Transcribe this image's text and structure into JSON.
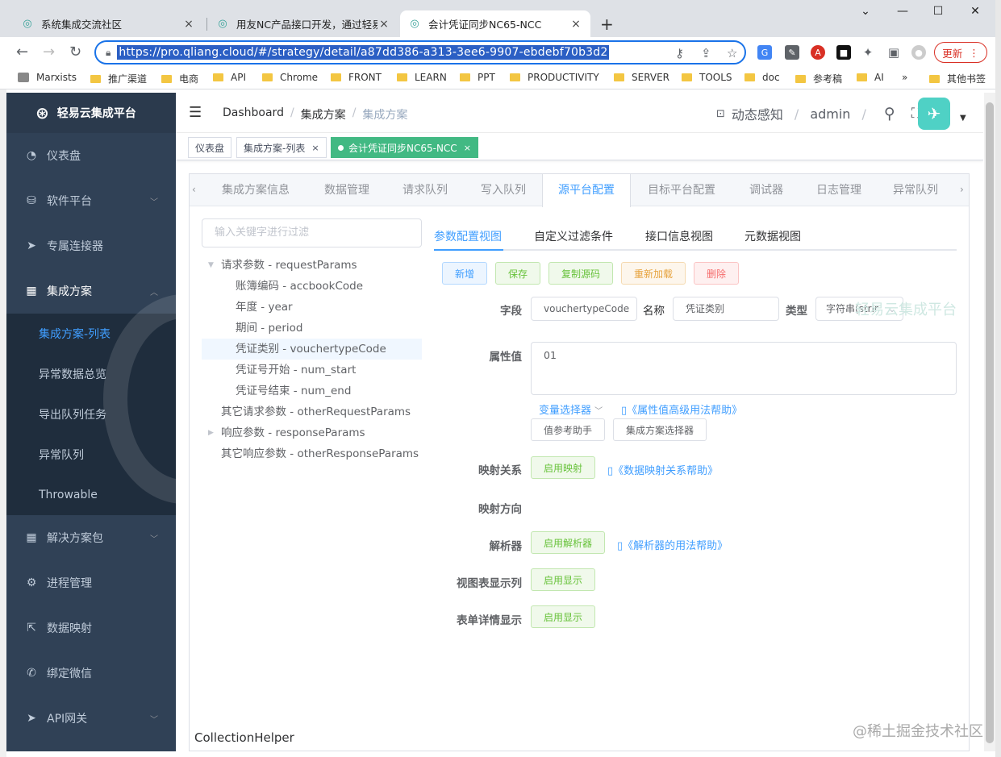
{
  "browser": {
    "tabs": [
      {
        "title": "系统集成交流社区"
      },
      {
        "title": "用友NC产品接口开发，通过轻易"
      },
      {
        "title": "会计凭证同步NC65-NCC"
      }
    ],
    "url": "https://pro.qliang.cloud/#/strategy/detail/a87dd386-a313-3ee6-9907-ebdebf70b3d2",
    "update_label": "更新",
    "bookmarks": [
      "Marxists",
      "推广渠道",
      "电商",
      "API",
      "Chrome",
      "FRONT",
      "LEARN",
      "PPT",
      "PRODUCTIVITY",
      "SERVER",
      "TOOLS",
      "doc",
      "参考稿",
      "AI",
      "其他书签"
    ]
  },
  "sidebar": {
    "logo": "轻易云集成平台",
    "items": [
      {
        "label": "仪表盘"
      },
      {
        "label": "软件平台"
      },
      {
        "label": "专属连接器"
      },
      {
        "label": "集成方案"
      },
      {
        "label": "解决方案包"
      },
      {
        "label": "进程管理"
      },
      {
        "label": "数据映射"
      },
      {
        "label": "绑定微信"
      },
      {
        "label": "API网关"
      }
    ],
    "subitems": [
      {
        "label": "集成方案-列表"
      },
      {
        "label": "异常数据总览"
      },
      {
        "label": "导出队列任务"
      },
      {
        "label": "异常队列"
      },
      {
        "label": "Throwable"
      }
    ]
  },
  "navbar": {
    "breadcrumb": [
      "Dashboard",
      "集成方案",
      "集成方案"
    ],
    "notify": "动态感知",
    "user": "admin"
  },
  "tags": [
    {
      "label": "仪表盘"
    },
    {
      "label": "集成方案-列表"
    },
    {
      "label": "会计凭证同步NC65-NCC"
    }
  ],
  "main_tabs": [
    "集成方案信息",
    "数据管理",
    "请求队列",
    "写入队列",
    "源平台配置",
    "目标平台配置",
    "调试器",
    "日志管理",
    "异常队列"
  ],
  "filter_placeholder": "输入关键字进行过滤",
  "tree": [
    {
      "label": "请求参数 - requestParams"
    },
    {
      "label": "账簿编码 - accbookCode"
    },
    {
      "label": "年度 - year"
    },
    {
      "label": "期间 - period"
    },
    {
      "label": "凭证类别 - vouchertypeCode"
    },
    {
      "label": "凭证号开始 - num_start"
    },
    {
      "label": "凭证号结束 - num_end"
    },
    {
      "label": "其它请求参数 - otherRequestParams"
    },
    {
      "label": "响应参数 - responseParams"
    },
    {
      "label": "其它响应参数 - otherResponseParams"
    }
  ],
  "sub_tabs": [
    "参数配置视图",
    "自定义过滤条件",
    "接口信息视图",
    "元数据视图"
  ],
  "actions": {
    "add": "新增",
    "save": "保存",
    "copy": "复制源码",
    "reload": "重新加载",
    "delete": "删除"
  },
  "form": {
    "field_label": "字段",
    "field_value": "vouchertypeCode",
    "name_label": "名称",
    "name_value": "凭证类别",
    "type_label": "类型",
    "type_value": "字符串(strir",
    "attr_label": "属性值",
    "attr_value": "01",
    "var_selector": "变量选择器",
    "attr_help": "《属性值高级用法帮助》",
    "value_helper": "值参考助手",
    "scheme_selector": "集成方案选择器",
    "mapping_label": "映射关系",
    "mapping_btn": "启用映射",
    "mapping_help": "《数据映射关系帮助》",
    "direction_label": "映射方向",
    "parser_label": "解析器",
    "parser_btn": "启用解析器",
    "parser_help": "《解析器的用法帮助》",
    "view_col_label": "视图表显示列",
    "view_col_btn": "启用显示",
    "detail_label": "表单详情显示",
    "detail_btn": "启用显示"
  },
  "bottom_text": "CollectionHelper",
  "ghost_text": "轻易云集成平台",
  "watermark": "@稀土掘金技术社区"
}
